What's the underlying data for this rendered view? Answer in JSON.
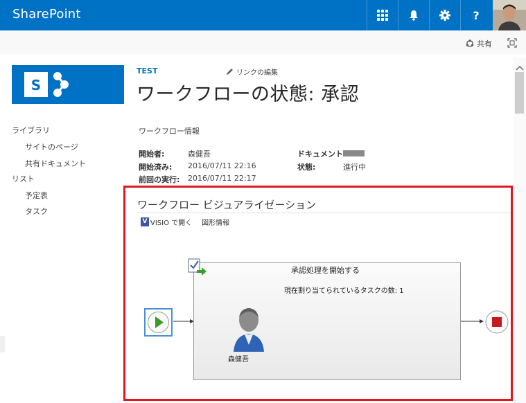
{
  "suitebar": {
    "brand": "SharePoint",
    "icons": [
      "app-launcher-icon",
      "bell-icon",
      "gear-icon",
      "help-icon"
    ],
    "help_label": "?"
  },
  "ribbon": {
    "share_label": "共有"
  },
  "site": {
    "title": "TEST",
    "edit_links_label": "リンクの編集"
  },
  "page": {
    "title": "ワークフローの状態: 承認"
  },
  "nav": {
    "items": [
      {
        "label": "ライブラリ",
        "level": 0
      },
      {
        "label": "サイトのページ",
        "level": 1
      },
      {
        "label": "共有ドキュメント",
        "level": 1
      },
      {
        "label": "リスト",
        "level": 0
      },
      {
        "label": "予定表",
        "level": 1
      },
      {
        "label": "タスク",
        "level": 1
      }
    ]
  },
  "info": {
    "section_label": "ワークフロー情報",
    "initiator_label": "開始者:",
    "initiator_value": "森健吾",
    "started_label": "開始済み:",
    "started_value": "2016/07/11 22:16",
    "last_run_label": "前回の実行:",
    "last_run_value": "2016/07/11 22:17",
    "document_label": "ドキュメント:",
    "status_label": "状態:",
    "status_value": "進行中"
  },
  "visualization": {
    "title": "ワークフロー ビジュアライゼーション",
    "open_in_visio_label": "VISIO で開く",
    "shape_info_label": "図形情報",
    "visio_icon_text": "V",
    "process_title": "承認処理を開始する",
    "process_tasks": "現在割り当てられているタスクの数: 1",
    "assignee": "森健吾"
  },
  "colors": {
    "suitebar": "#0072c6",
    "highlight": "#e6141e",
    "link": "#0072c6"
  }
}
